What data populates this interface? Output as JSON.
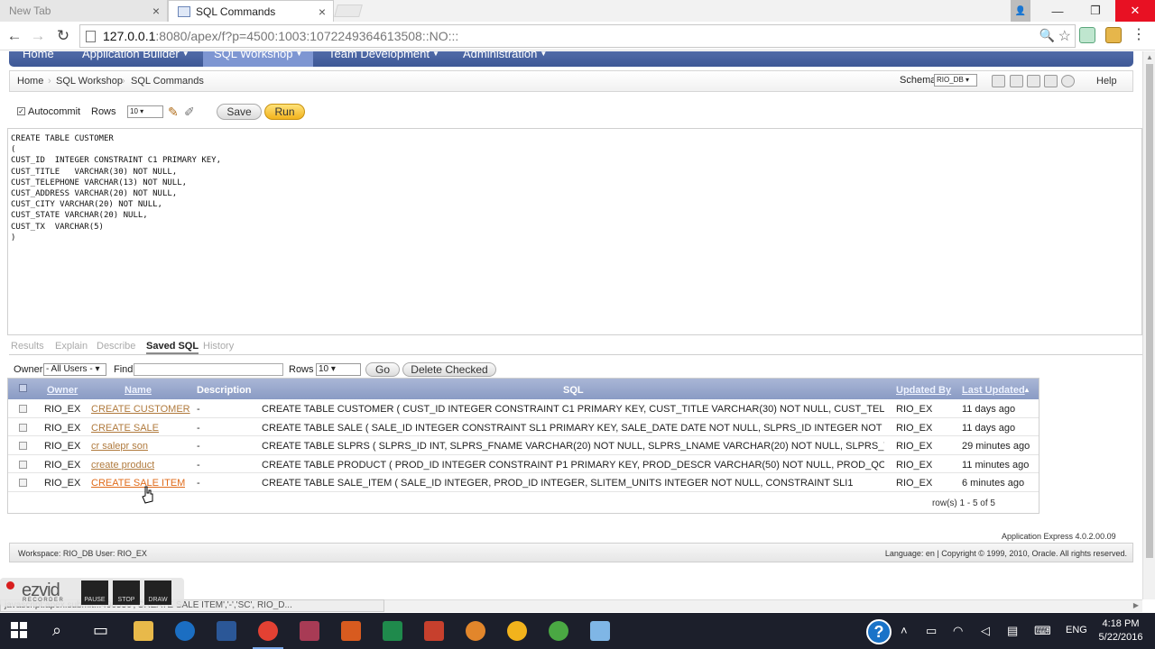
{
  "browser": {
    "tabs": [
      {
        "label": "New Tab"
      },
      {
        "label": "SQL Commands"
      }
    ],
    "url_host": "127.0.0.1",
    "url_rest": ":8080/apex/f?p=4500:1003:1072249364613508::NO:::"
  },
  "nav": {
    "items": [
      {
        "label": "Home"
      },
      {
        "label": "Application Builder"
      },
      {
        "label": "SQL Workshop"
      },
      {
        "label": "Team Development"
      },
      {
        "label": "Administration"
      }
    ]
  },
  "breadcrumb": {
    "items": [
      "Home",
      "SQL Workshop",
      "SQL Commands"
    ],
    "schema_label": "Schema",
    "schema_value": "RIO_DB",
    "help": "Help"
  },
  "command_bar": {
    "autocommit": "Autocommit",
    "rows_label": "Rows",
    "rows_value": "10",
    "save": "Save",
    "run": "Run"
  },
  "editor": {
    "sql": "CREATE TABLE CUSTOMER\n(\nCUST_ID  INTEGER CONSTRAINT C1 PRIMARY KEY,\nCUST_TITLE   VARCHAR(30) NOT NULL,\nCUST_TELEPHONE VARCHAR(13) NOT NULL,\nCUST_ADDRESS VARCHAR(20) NOT NULL,\nCUST_CITY VARCHAR(20) NOT NULL,\nCUST_STATE VARCHAR(20) NULL,\nCUST_TX  VARCHAR(5)\n)"
  },
  "result_tabs": [
    "Results",
    "Explain",
    "Describe",
    "Saved SQL",
    "History"
  ],
  "filters": {
    "owner_label": "Owner",
    "owner_value": "- All Users -",
    "find_label": "Find",
    "rows_label": "Rows",
    "rows_value": "10",
    "go": "Go",
    "delete_checked": "Delete Checked"
  },
  "table": {
    "headers": {
      "owner": "Owner",
      "name": "Name",
      "description": "Description",
      "sql": "SQL",
      "updated_by": "Updated By",
      "last_updated": "Last Updated"
    },
    "rows": [
      {
        "owner": "RIO_EX",
        "name": "CREATE CUSTOMER",
        "description": "-",
        "sql": "CREATE TABLE CUSTOMER ( CUST_ID INTEGER CONSTRAINT C1 PRIMARY KEY, CUST_TITLE VARCHAR(30) NOT NULL, CUST_TELEPHON",
        "updated_by": "RIO_EX",
        "last_updated": "11 days ago"
      },
      {
        "owner": "RIO_EX",
        "name": "CREATE SALE",
        "description": "-",
        "sql": "CREATE TABLE SALE ( SALE_ID INTEGER CONSTRAINT SL1 PRIMARY KEY, SALE_DATE DATE NOT NULL, SLPRS_ID INTEGER NOT NULL,",
        "updated_by": "RIO_EX",
        "last_updated": "11 days ago"
      },
      {
        "owner": "RIO_EX",
        "name": "cr salepr son",
        "description": "-",
        "sql": "CREATE TABLE SLPRS ( SLPRS_ID INT, SLPRS_FNAME VARCHAR(20) NOT NULL, SLPRS_LNAME VARCHAR(20) NOT NULL, SLPRS_TELEPH",
        "updated_by": "RIO_EX",
        "last_updated": "29 minutes ago"
      },
      {
        "owner": "RIO_EX",
        "name": "create product",
        "description": "-",
        "sql": "CREATE TABLE PRODUCT ( PROD_ID INTEGER CONSTRAINT P1 PRIMARY KEY, PROD_DESCR VARCHAR(50) NOT NULL, PROD_QOH INTEGE",
        "updated_by": "RIO_EX",
        "last_updated": "11 minutes ago"
      },
      {
        "owner": "RIO_EX",
        "name": "CREATE SALE ITEM",
        "description": "-",
        "sql": "CREATE TABLE SALE_ITEM ( SALE_ID INTEGER, PROD_ID INTEGER, SLITEM_UNITS INTEGER NOT NULL, CONSTRAINT SLI1",
        "updated_by": "RIO_EX",
        "last_updated": "6 minutes ago"
      }
    ],
    "rows_info": "row(s) 1 - 5 of 5"
  },
  "footer": {
    "version": "Application Express 4.0.2.00.09",
    "workspace": "Workspace: RIO_DB User: RIO_EX",
    "copyright": "Language: en | Copyright © 1999, 2010, Oracle. All rights reserved."
  },
  "status_url": "javascript:apex.submit...496536','CREATE SALE ITEM','-','SC', RIO_D...",
  "recorder": {
    "logo": "ezvid",
    "sub": "RECORDER",
    "pause": "PAUSE",
    "stop": "STOP",
    "draw": "DRAW"
  },
  "taskbar": {
    "lang": "ENG",
    "time": "4:18 PM",
    "date": "5/22/2016"
  }
}
